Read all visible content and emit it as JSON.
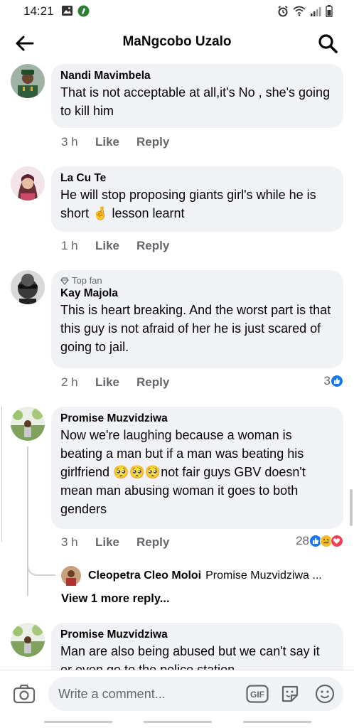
{
  "status_bar": {
    "time": "14:21"
  },
  "header": {
    "title": "MaNgcobo Uzalo"
  },
  "comments": [
    {
      "name": "Nandi Mavimbela",
      "text": "That is not acceptable at all,it's No , she's going to kill him",
      "time": "3 h",
      "like": "Like",
      "reply": "Reply"
    },
    {
      "name": "La Cu Te",
      "text_before": "He will stop proposing giants girl's while he is short ",
      "text_emoji": "🤞",
      "text_after": " lesson learnt",
      "time": "1 h",
      "like": "Like",
      "reply": "Reply"
    },
    {
      "badge": "Top fan",
      "name": "Kay Majola",
      "text": "This is heart breaking. And the worst part is that this guy is not afraid of her he is just scared of going to jail.",
      "time": "2 h",
      "like": "Like",
      "reply": "Reply",
      "reaction_count": "3"
    },
    {
      "name": "Promise Muzvidziwa",
      "text_before": "Now we're laughing because a woman is beating a man but if a man was beating his girlfriend ",
      "text_emoji": "🥺🥺🥺",
      "text_after": "not fair guys GBV doesn't mean man abusing woman it goes to both genders",
      "time": "3 h",
      "like": "Like",
      "reply": "Reply",
      "reaction_count": "28",
      "reply_preview": {
        "name": "Cleopetra Cleo Moloi",
        "text": "Promise Muzvidziwa ..."
      },
      "view_more": "View 1 more reply..."
    },
    {
      "name": "Promise Muzvidziwa",
      "text": "Man are also being abused but we can't say it or even go to the police station"
    }
  ],
  "composer": {
    "placeholder": "Write a comment...",
    "gif_label": "GIF"
  },
  "colors": {
    "like_blue": "#1877f2",
    "sad_yellow": "#f7b928",
    "love_red": "#f33e58",
    "bubble_gray": "#f0f2f5",
    "meta_gray": "#65676b"
  }
}
